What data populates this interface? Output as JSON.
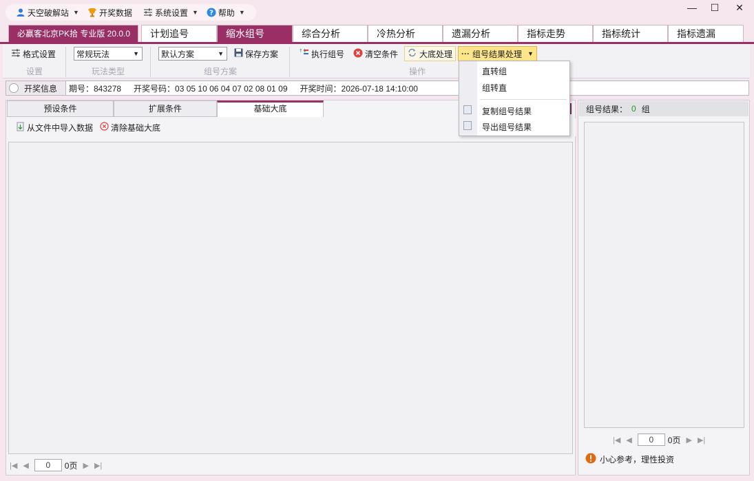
{
  "topmenu": {
    "items": [
      {
        "label": "天空破解站",
        "icon": "user-icon"
      },
      {
        "label": "开奖数据",
        "icon": "trophy-icon"
      },
      {
        "label": "系统设置",
        "icon": "settings-sliders-icon"
      },
      {
        "label": "帮助",
        "icon": "help-icon"
      }
    ]
  },
  "window": {
    "minimize": "—",
    "maximize": "☐",
    "close": "✕"
  },
  "main_tabs": {
    "brand": "必赢客北京PK拾 专业版 20.0.0",
    "tabs": [
      "计划追号",
      "缩水组号",
      "综合分析",
      "冷热分析",
      "遗漏分析",
      "指标走势",
      "指标统计",
      "指标遗漏"
    ],
    "active": "缩水组号"
  },
  "ribbon": {
    "format_settings": "格式设置",
    "play_type_value": "常规玩法",
    "scheme_value": "默认方案",
    "save_scheme": "保存方案",
    "execute": "执行组号",
    "clear": "清空条件",
    "large_base": "大底处理",
    "result_process": "组号结果处理",
    "groups": {
      "settings": "设置",
      "play_type": "玩法类型",
      "scheme": "组号方案",
      "operation": "操作"
    }
  },
  "info": {
    "label": "开奖信息",
    "period": "期号：843278",
    "numbers": "开奖号码：03 05 10 06 04 07 02 08 01 09",
    "time": "开奖时间：2026-07-18 14:10:00"
  },
  "sub_tabs": [
    "预设条件",
    "扩展条件",
    "基础大底"
  ],
  "sub_tabs_active": "基础大底",
  "sub_toolbar": {
    "import": "从文件中导入数据",
    "clear_base": "清除基础大底"
  },
  "left_pager": {
    "value": "0",
    "label": "0页"
  },
  "right": {
    "header_label": "组号结果：",
    "count": "0",
    "unit": "组",
    "pager_value": "0",
    "pager_label": "0页",
    "note": "小心参考，理性投资"
  },
  "popup": {
    "items": [
      "直转组",
      "组转直",
      "复制组号结果",
      "导出组号结果"
    ]
  },
  "colors": {
    "accent": "#9a2f66",
    "background": "#f6e6ee",
    "count_green": "#1a9a1a",
    "warning_orange": "#e06a10"
  }
}
